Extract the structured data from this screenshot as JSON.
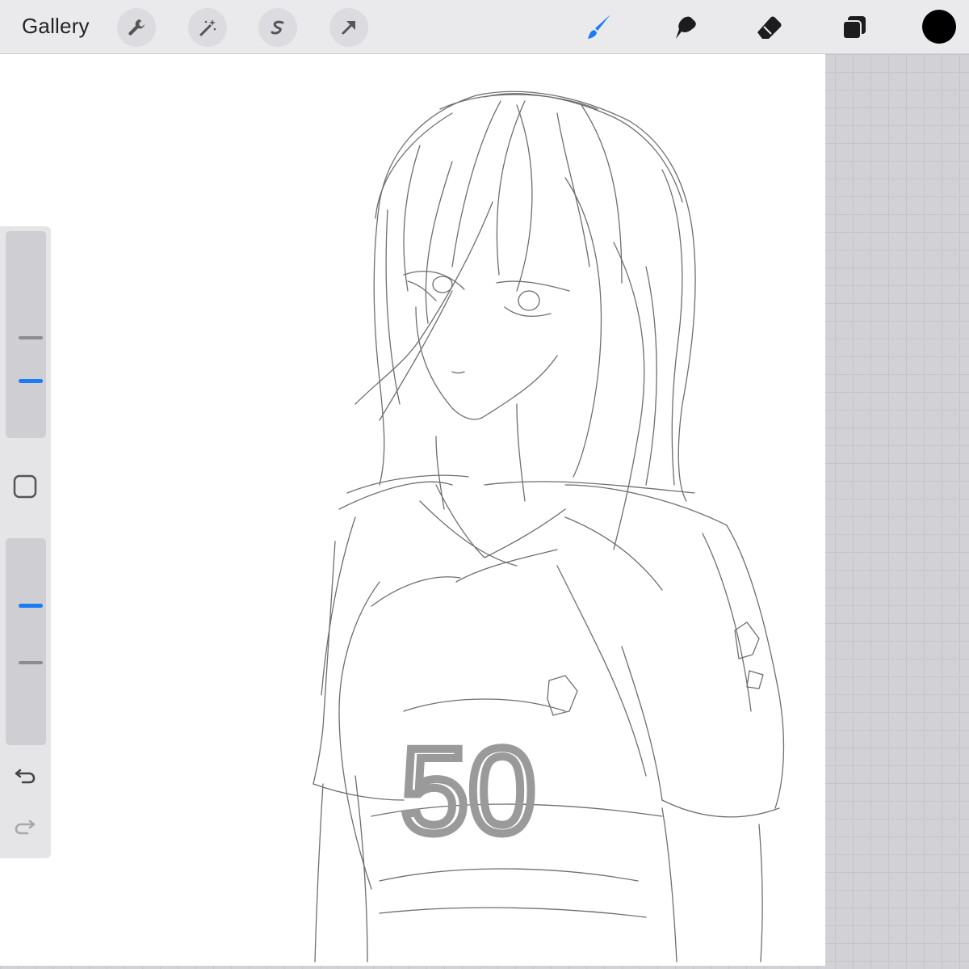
{
  "toolbar": {
    "gallery_label": "Gallery",
    "left_tools": [
      "wrench-icon",
      "magic-wand-icon",
      "selection-icon",
      "transform-arrow-icon"
    ],
    "right_tools": [
      "brush-icon",
      "smudge-icon",
      "eraser-icon",
      "layers-icon"
    ],
    "active_tool": "brush",
    "current_color": "#000000"
  },
  "sidebar": {
    "brush_size_slider": {
      "value": 0.3
    },
    "modify_button": "square-icon",
    "opacity_slider": {
      "value": 0.7
    },
    "undo": "undo-icon",
    "redo": "redo-icon"
  },
  "canvas": {
    "jersey_number": "50"
  },
  "colors": {
    "accent": "#1a7cf5",
    "toolbar_bg": "#eaeaec",
    "workspace_bg": "#d1d1d6"
  }
}
